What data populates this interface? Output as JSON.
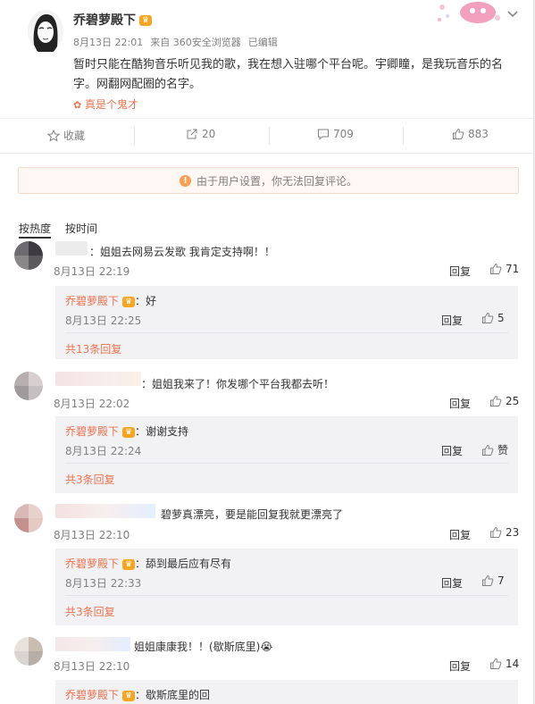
{
  "post": {
    "author": "乔碧萝殿下",
    "date": "8月13日 22:01",
    "source": "来自 360安全浏览器",
    "edited": "已编辑",
    "text": "暂时只能在酷狗音乐听见我的歌，我在想入驻哪个平台呢。宇卿瞳，是我玩音乐的名字。网翻网配圈的名字。",
    "topic": "真是个鬼才"
  },
  "actions": {
    "favorite": "收藏",
    "repost_count": "20",
    "comment_count": "709",
    "like_count": "883"
  },
  "notice": "由于用户设置，你无法回复评论。",
  "sort_tabs": [
    "按热度",
    "按时间"
  ],
  "comments": [
    {
      "text": "：姐姐去网易云发歌 我肯定支持啊！！",
      "time": "8月13日 22:19",
      "reply_label": "回复",
      "likes": "71",
      "sub": {
        "name": "乔碧萝殿下",
        "text": "：好",
        "time": "8月13日 22:25",
        "reply_label": "回复",
        "likes": "5",
        "more": "共13条回复"
      }
    },
    {
      "text": "：姐姐我来了！你发哪个平台我都去听！",
      "time": "8月13日 22:02",
      "reply_label": "回复",
      "likes": "25",
      "sub": {
        "name": "乔碧萝殿下",
        "text": "：谢谢支持",
        "time": "8月13日 22:24",
        "reply_label": "回复",
        "likes": "赞",
        "more": "共3条回复"
      }
    },
    {
      "text": "碧萝真漂亮，要是能回复我就更漂亮了",
      "time": "8月13日 22:10",
      "reply_label": "回复",
      "likes": "23",
      "sub": {
        "name": "乔碧萝殿下",
        "text": "：舔到最后应有尽有",
        "time": "8月13日 22:33",
        "reply_label": "回复",
        "likes": "7",
        "more": "共3条回复"
      }
    },
    {
      "text": "姐姐康康我！！(歇斯底里)😭",
      "time": "8月13日 22:10",
      "reply_label": "回复",
      "likes": "14",
      "sub": {
        "name": "乔碧萝殿下",
        "text": "：歇斯底里的回"
      }
    }
  ],
  "icons": {
    "star": "star-icon",
    "repost": "repost-icon",
    "comment": "comment-icon",
    "like": "thumb-up-icon",
    "warning": "warning-icon",
    "chevron": "chevron-down-icon"
  },
  "colors": {
    "accent": "#eb7350",
    "muted": "#808080",
    "notice_bg": "#fff7f3"
  }
}
